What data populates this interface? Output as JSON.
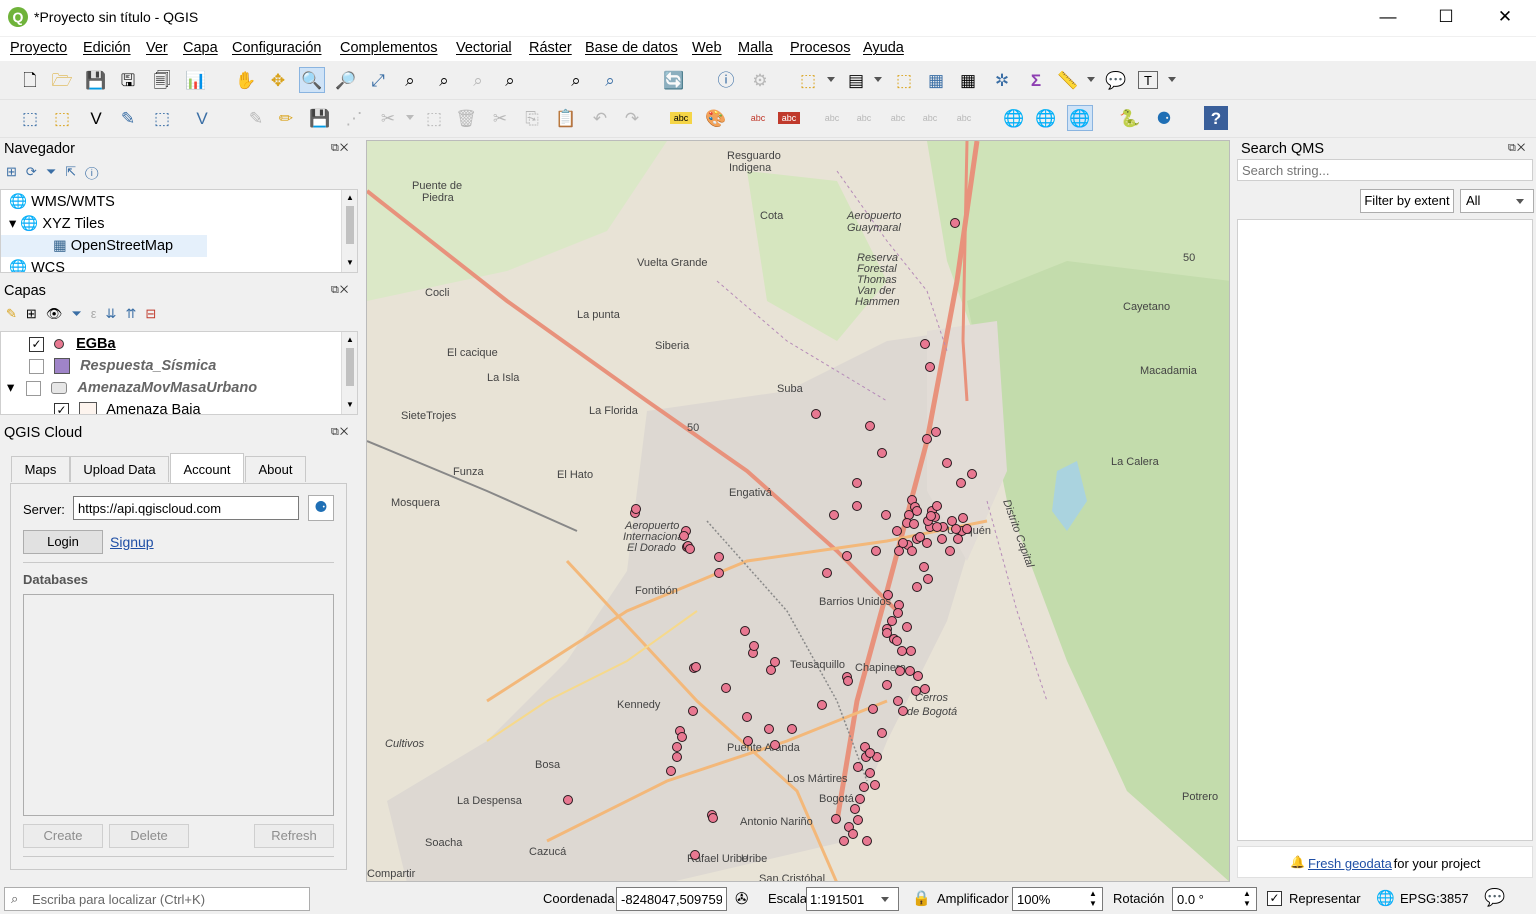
{
  "window": {
    "title": "*Proyecto sin título - QGIS",
    "minimize": "—",
    "maximize": "☐",
    "close": "✕"
  },
  "menu": [
    "Proyecto",
    "Edición",
    "Ver",
    "Capa",
    "Configuración",
    "Complementos",
    "Vectorial",
    "Ráster",
    "Base de datos",
    "Web",
    "Malla",
    "Procesos",
    "Ayuda"
  ],
  "toolbar1": [
    "🗋",
    "🗁",
    "💾",
    "🖫",
    "🗐",
    "📊",
    "✋",
    "✥",
    "🔍",
    "🔎",
    "⤢",
    "⌕",
    "⌕",
    "⌕",
    "⌕",
    "⌕",
    "⌕",
    "🔄",
    "ⓘ",
    "⚙",
    "⬚",
    "▤",
    "⬚",
    "▦",
    "▦",
    "✲",
    "Σ",
    "📏",
    "💬",
    "T"
  ],
  "toolbar2": [
    "⬚",
    "⬚",
    "V",
    "✎",
    "⬚",
    "V",
    "✎",
    "✏",
    "💾",
    "⋰",
    "✂",
    "⬚",
    "🗑",
    "✂",
    "⎘",
    "📋",
    "↶",
    "↷",
    "abc",
    "🎨",
    "abc",
    "abc",
    "abc",
    "abc",
    "abc",
    "abc",
    "abc",
    "🌐",
    "🌐",
    "🌐",
    "🐍",
    "⚈",
    "?"
  ],
  "navigator": {
    "title": "Navegador",
    "items": [
      {
        "label": "WMS/WMTS",
        "expander": ""
      },
      {
        "label": "XYZ Tiles",
        "expander": "▾"
      },
      {
        "label": "OpenStreetMap",
        "expander": ""
      },
      {
        "label": "WCS",
        "expander": ""
      }
    ]
  },
  "layers": {
    "title": "Capas",
    "items": [
      {
        "label": "EGBa",
        "checked": true,
        "bold": true,
        "underline": true,
        "italic": false,
        "swatch": "#e87891",
        "shape": "circle"
      },
      {
        "label": "Respuesta_Sísmica",
        "checked": false,
        "bold": true,
        "italic": true,
        "swatch": "#9f84c8",
        "shape": "square"
      },
      {
        "label": "AmenazaMovMasaUrbano",
        "checked": false,
        "bold": true,
        "italic": true,
        "swatch": "#c8c8c8",
        "shape": "group"
      },
      {
        "label": "Amenaza Baja",
        "checked": true,
        "bold": false,
        "italic": false,
        "swatch": "#fdf4ee",
        "shape": "square"
      }
    ]
  },
  "qgis_cloud": {
    "title": "QGIS Cloud",
    "tabs": [
      "Maps",
      "Upload Data",
      "Account",
      "About"
    ],
    "active_tab": "Account",
    "server_label": "Server:",
    "server_value": "https://api.qgiscloud.com",
    "login": "Login",
    "signup": "Signup",
    "databases": "Databases",
    "create": "Create",
    "delete": "Delete",
    "refresh": "Refresh"
  },
  "search_qms": {
    "title": "Search QMS",
    "placeholder": "Search string...",
    "filter_button": "Filter by extent",
    "filter_select": "All",
    "footer_link": "Fresh geodata",
    "footer_text": " for your project"
  },
  "map": {
    "labels": [
      {
        "t": "Resguardo"
      },
      {
        "t": "Indigena"
      },
      {
        "t": "Cota"
      },
      {
        "t": "Puente de"
      },
      {
        "t": "Piedra"
      },
      {
        "t": "Aeropuerto"
      },
      {
        "t": "Guaymaral"
      },
      {
        "t": "Vuelta Grande"
      },
      {
        "t": "Reserva"
      },
      {
        "t": "Forestal"
      },
      {
        "t": "Thomas"
      },
      {
        "t": "Van der"
      },
      {
        "t": "Hammen"
      },
      {
        "t": "Cocli"
      },
      {
        "t": "La punta"
      },
      {
        "t": "El cacique"
      },
      {
        "t": "Siberia"
      },
      {
        "t": "La Isla"
      },
      {
        "t": "Suba"
      },
      {
        "t": "SieteTrojes"
      },
      {
        "t": "La Florida"
      },
      {
        "t": "Funza"
      },
      {
        "t": "El Hato"
      },
      {
        "t": "Mosquera"
      },
      {
        "t": "Engativá"
      },
      {
        "t": "Aeropuerto"
      },
      {
        "t": "Internacional"
      },
      {
        "t": "El Dorado"
      },
      {
        "t": "Fontibón"
      },
      {
        "t": "Usaquén"
      },
      {
        "t": "Barrios Unidos"
      },
      {
        "t": "Teusaquillo"
      },
      {
        "t": "Chapinero"
      },
      {
        "t": "Kennedy"
      },
      {
        "t": "Cerros"
      },
      {
        "t": "de Bogotá"
      },
      {
        "t": "Cultivos"
      },
      {
        "t": "Puente Aranda"
      },
      {
        "t": "Bosa"
      },
      {
        "t": "Los Mártires"
      },
      {
        "t": "Bogotá"
      },
      {
        "t": "La Despensa"
      },
      {
        "t": "Antonio Nariño"
      },
      {
        "t": "Soacha"
      },
      {
        "t": "Cazucá"
      },
      {
        "t": "Rafael Uribe"
      },
      {
        "t": "Uribe"
      },
      {
        "t": "San Cristóbal"
      },
      {
        "t": "Compartir"
      },
      {
        "t": "Cayetano"
      },
      {
        "t": "Macadamia"
      },
      {
        "t": "La Calera"
      },
      {
        "t": "Potrero"
      },
      {
        "t": "Distrito Capital"
      },
      {
        "t": "50"
      },
      {
        "t": "50"
      }
    ],
    "point_color": "#e87891"
  },
  "statusbar": {
    "locator_placeholder": "Escriba para localizar (Ctrl+K)",
    "coord_label": "Coordenada",
    "coord_value": "-8248047,509759",
    "scale_label": "Escala",
    "scale_value": "1:191501",
    "magnifier_label": "Amplificador",
    "magnifier_value": "100%",
    "rotation_label": "Rotación",
    "rotation_value": "0.0 °",
    "render_label": "Representar",
    "crs": "EPSG:3857"
  }
}
